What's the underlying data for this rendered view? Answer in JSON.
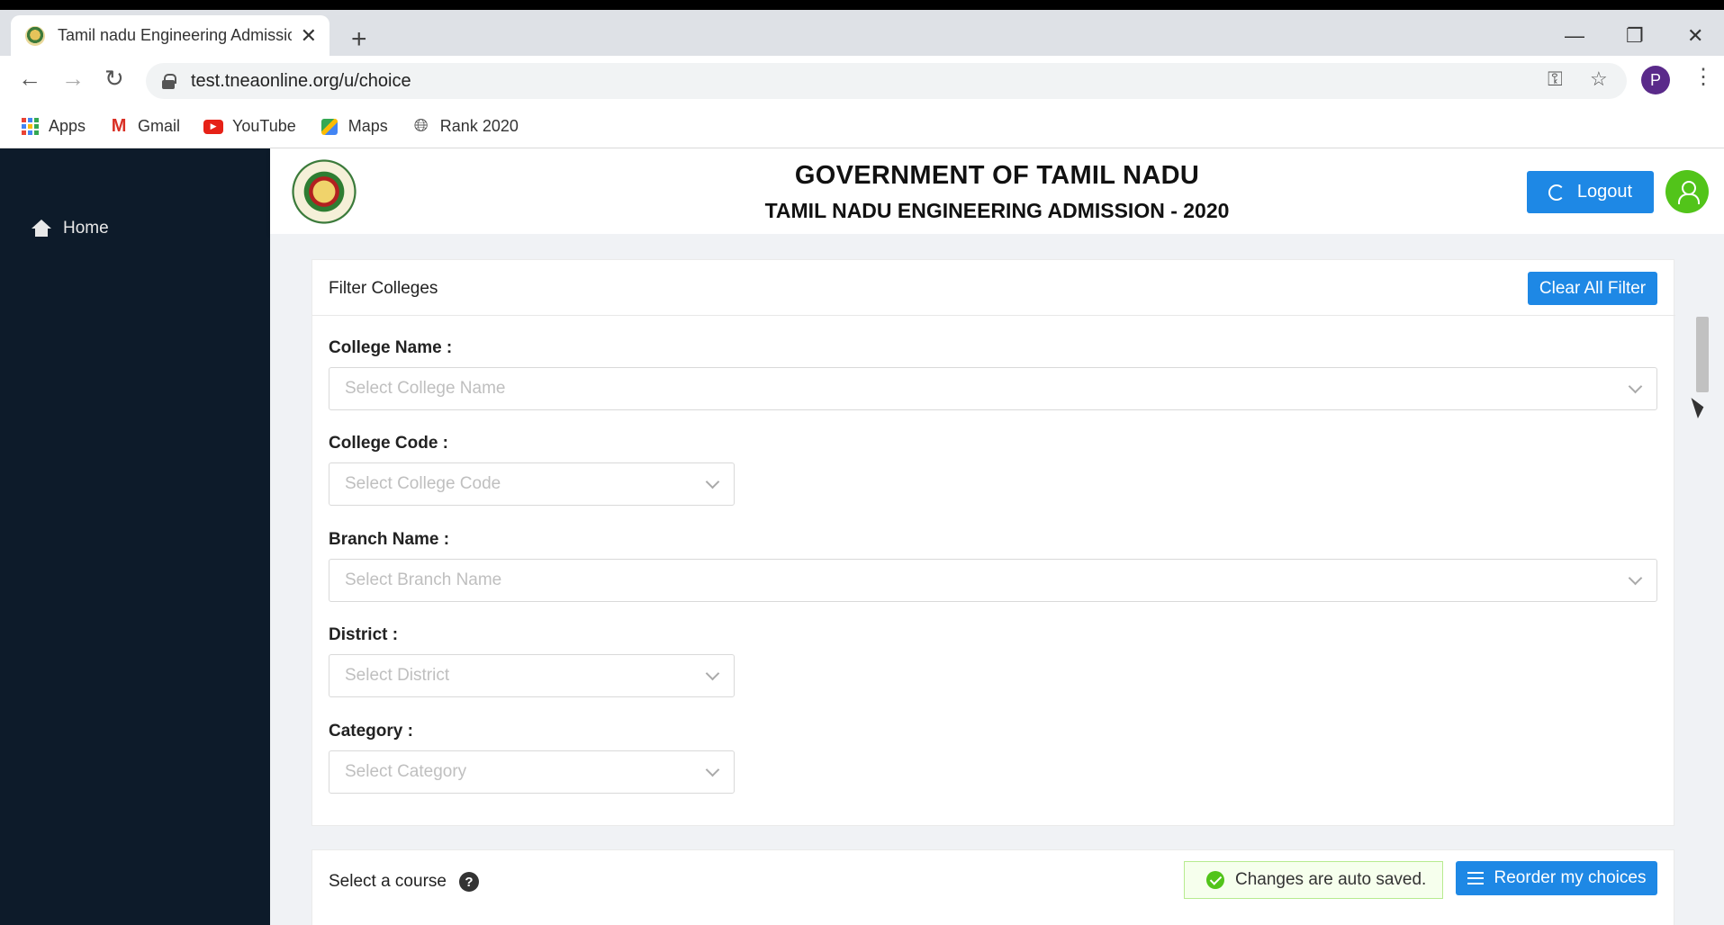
{
  "browser": {
    "tab_title": "Tamil nadu Engineering Admissio",
    "tab_close": "✕",
    "new_tab": "+",
    "url": "test.tneaonline.org/u/choice",
    "profile_initial": "P",
    "bookmarks": [
      {
        "label": "Apps"
      },
      {
        "label": "Gmail"
      },
      {
        "label": "YouTube"
      },
      {
        "label": "Maps"
      },
      {
        "label": "Rank 2020"
      }
    ]
  },
  "sidebar": {
    "items": [
      {
        "label": "Home",
        "icon": "home-icon"
      }
    ]
  },
  "header": {
    "title": "GOVERNMENT OF TAMIL NADU",
    "subtitle": "TAMIL NADU ENGINEERING ADMISSION - 2020",
    "logout_label": "Logout"
  },
  "filter": {
    "title": "Filter Colleges",
    "clear_label": "Clear All Filter",
    "fields": [
      {
        "label": "College Name :",
        "placeholder": "Select College Name"
      },
      {
        "label": "College Code :",
        "placeholder": "Select College Code"
      },
      {
        "label": "Branch Name :",
        "placeholder": "Select Branch Name"
      },
      {
        "label": "District :",
        "placeholder": "Select District"
      },
      {
        "label": "Category :",
        "placeholder": "Select Category"
      }
    ]
  },
  "course": {
    "label": "Select a course",
    "help_glyph": "?",
    "autosave_text": "Changes are auto saved.",
    "reorder_label": "Reorder my choices"
  },
  "colors": {
    "primary": "#1e88e5",
    "sidebar": "#0d1b2a",
    "success": "#52c41a"
  }
}
